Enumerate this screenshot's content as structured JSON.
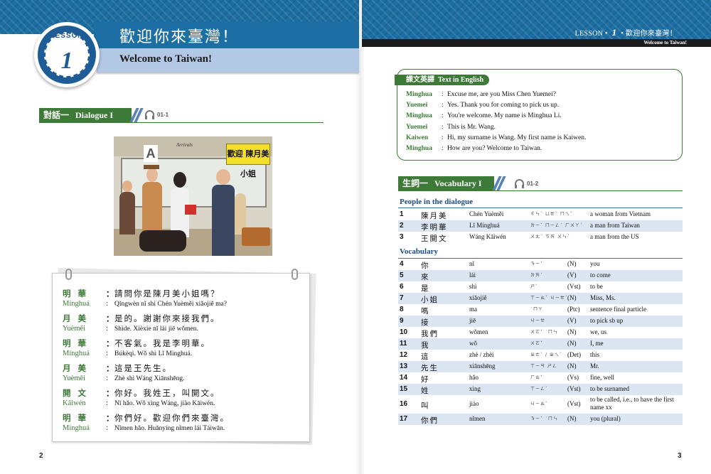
{
  "lesson": {
    "badge_label": "LESSON",
    "badge_number": "1",
    "title_cn": "歡迎你來臺灣！",
    "title_en": "Welcome to Taiwan!"
  },
  "running_head": {
    "label": "LESSON",
    "bullet": "•",
    "number": "1",
    "title_cn": "歡迎你來臺灣！",
    "bar_text": "Welcome to Taiwan!"
  },
  "dialogue_section": {
    "cn": "對話一",
    "en": "Dialogue I",
    "audio": "01-1"
  },
  "illustration": {
    "sign_text": "歡迎 陳月美 小姐",
    "gate_letter": "A",
    "banner": "Arrivals"
  },
  "dialogue": [
    {
      "speaker_cn": "明華",
      "speaker_py": "Mínghuá",
      "cn": "請問你是陳月美小姐嗎？",
      "py": "Qǐngwèn nǐ shì Chén Yuèměi xiǎojiě ma?"
    },
    {
      "speaker_cn": "月美",
      "speaker_py": "Yuèměi",
      "cn": "是的。謝謝你來接我們。",
      "py": "Shìde. Xièxie nǐ lái jiē wǒmen."
    },
    {
      "speaker_cn": "明華",
      "speaker_py": "Mínghuá",
      "cn": "不客氣。我是李明華。",
      "py": "Búkèqì. Wǒ shì Lǐ Mínghuá."
    },
    {
      "speaker_cn": "月美",
      "speaker_py": "Yuèměi",
      "cn": "這是王先生。",
      "py": "Zhè shì Wáng Xiānshēng."
    },
    {
      "speaker_cn": "開文",
      "speaker_py": "Kāiwén",
      "cn": "你好。我姓王，叫開文。",
      "py": "Nǐ hǎo. Wǒ xìng Wáng, jiào Kāiwén."
    },
    {
      "speaker_cn": "明華",
      "speaker_py": "Mínghuá",
      "cn": "你們好。歡迎你們來臺灣。",
      "py": "Nǐmen hǎo. Huānyíng nǐmen lái Táiwān."
    }
  ],
  "page_numbers": {
    "left": "2",
    "right": "3"
  },
  "english_section": {
    "cn": "課文英譯",
    "en": "Text in English",
    "lines": [
      {
        "speaker": "Minghua",
        "text": "Excuse me, are you Miss Chen Yuemei?"
      },
      {
        "speaker": "Yuemei",
        "text": "Yes. Thank you for coming to pick us up."
      },
      {
        "speaker": "Minghua",
        "text": "You're welcome. My name is Minghua Li."
      },
      {
        "speaker": "Yuemei",
        "text": "This is Mr. Wang."
      },
      {
        "speaker": "Kaiwen",
        "text": "Hi, my surname is Wang. My first name is Kaiwen."
      },
      {
        "speaker": "Minghua",
        "text": "How are you? Welcome to Taiwan."
      }
    ]
  },
  "vocab_section": {
    "cn": "生詞一",
    "en": "Vocabulary I",
    "audio": "01-2",
    "group_people": "People in the dialogue",
    "group_vocab": "Vocabulary",
    "people": [
      {
        "n": "1",
        "cn": "陳月美",
        "py": "Chén Yuèměi",
        "bpm": "ㄔㄣˊ ㄩㄝˋ ㄇㄟˇ",
        "pos": "",
        "en": "a woman from Vietnam"
      },
      {
        "n": "2",
        "cn": "李明華",
        "py": "Lǐ Mínghuá",
        "bpm": "ㄌㄧˇ ㄇㄧㄥˊ ㄏㄨㄚˊ",
        "pos": "",
        "en": "a man from Taiwan"
      },
      {
        "n": "3",
        "cn": "王開文",
        "py": "Wáng Kāiwén",
        "bpm": "ㄨㄤˊ ㄎㄞ ㄨㄣˊ",
        "pos": "",
        "en": "a man from the US"
      }
    ],
    "words": [
      {
        "n": "4",
        "cn": "你",
        "py": "nǐ",
        "bpm": "ㄋㄧˇ",
        "pos": "(N)",
        "en": "you"
      },
      {
        "n": "5",
        "cn": "來",
        "py": "lái",
        "bpm": "ㄌㄞˊ",
        "pos": "(V)",
        "en": "to come"
      },
      {
        "n": "6",
        "cn": "是",
        "py": "shì",
        "bpm": "ㄕˋ",
        "pos": "(Vst)",
        "en": "to be"
      },
      {
        "n": "7",
        "cn": "小姐",
        "py": "xiǎojiě",
        "bpm": "ㄒㄧㄠˇ ㄐㄧㄝˇ",
        "pos": "(N)",
        "en": "Miss, Ms."
      },
      {
        "n": "8",
        "cn": "嗎",
        "py": "ma",
        "bpm": "˙ㄇㄚ",
        "pos": "(Ptc)",
        "en": "sentence final particle"
      },
      {
        "n": "9",
        "cn": "接",
        "py": "jiē",
        "bpm": "ㄐㄧㄝ",
        "pos": "(V)",
        "en": "to pick sb up"
      },
      {
        "n": "10",
        "cn": "我們",
        "py": "wǒmen",
        "bpm": "ㄨㄛˇ ˙ㄇㄣ",
        "pos": "(N)",
        "en": "we, us"
      },
      {
        "n": "11",
        "cn": "我",
        "py": "wǒ",
        "bpm": "ㄨㄛˇ",
        "pos": "(N)",
        "en": "I, me"
      },
      {
        "n": "12",
        "cn": "這",
        "py": "zhè / zhèi",
        "bpm": "ㄓㄜˋ / ㄓㄟˋ",
        "pos": "(Det)",
        "en": "this"
      },
      {
        "n": "13",
        "cn": "先生",
        "py": "xiānshēng",
        "bpm": "ㄒㄧㄢ ㄕㄥ",
        "pos": "(N)",
        "en": "Mr."
      },
      {
        "n": "14",
        "cn": "好",
        "py": "hǎo",
        "bpm": "ㄏㄠˇ",
        "pos": "(Vs)",
        "en": "fine, well"
      },
      {
        "n": "15",
        "cn": "姓",
        "py": "xìng",
        "bpm": "ㄒㄧㄥˋ",
        "pos": "(Vst)",
        "en": "to be surnamed"
      },
      {
        "n": "16",
        "cn": "叫",
        "py": "jiào",
        "bpm": "ㄐㄧㄠˋ",
        "pos": "(Vst)",
        "en": "to be called, i.e., to have the first name xx"
      },
      {
        "n": "17",
        "cn": "你們",
        "py": "nǐmen",
        "bpm": "ㄋㄧˇ ˙ㄇㄣ",
        "pos": "(N)",
        "en": "you (plural)"
      }
    ]
  }
}
